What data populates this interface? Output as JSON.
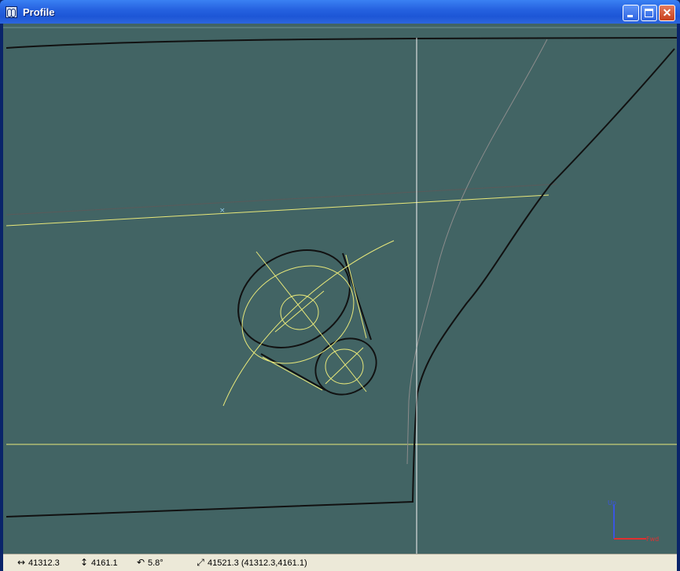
{
  "window": {
    "title": "Profile",
    "icon": "profile-app-icon",
    "controls": {
      "minimize": "minimize",
      "maximize": "maximize",
      "close": "close"
    }
  },
  "canvas": {
    "background": "#426464",
    "contour_color": "#111111",
    "construction_color": "#e8e87a",
    "crosshair_color": "#f5f5f5",
    "axis": {
      "up_label": "Up",
      "fwd_label": "Fwd",
      "up_color": "#3a55e0",
      "fwd_color": "#e03030"
    }
  },
  "status": {
    "x_icon": "horizontal-arrows-icon",
    "x": "41312.3",
    "y_icon": "vertical-arrows-icon",
    "y": "4161.1",
    "angle_icon": "rotate-icon",
    "angle": "5.8°",
    "dist_icon": "diagonal-arrow-icon",
    "dist": "41521.3 (41312.3,4161.1)"
  }
}
